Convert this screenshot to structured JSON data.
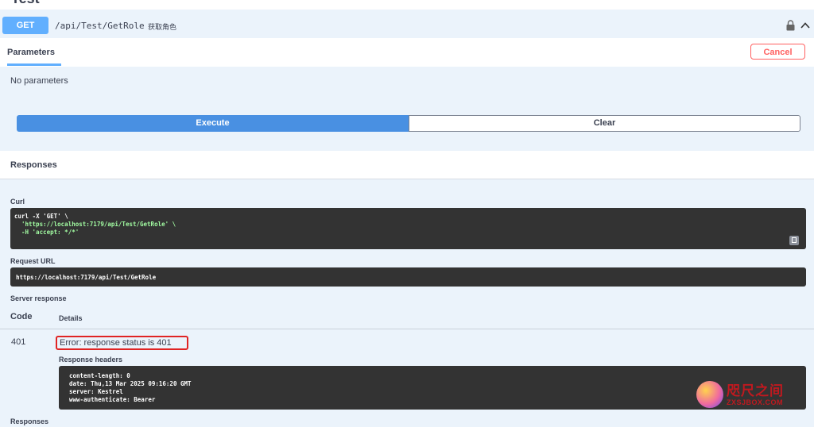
{
  "cut_title": "Test",
  "operation": {
    "method": "GET",
    "path": "/api/Test/GetRole",
    "description": "获取角色"
  },
  "parameters": {
    "tab_label": "Parameters",
    "cancel_label": "Cancel",
    "empty_text": "No parameters"
  },
  "actions": {
    "execute_label": "Execute",
    "clear_label": "Clear"
  },
  "responses": {
    "title": "Responses",
    "curl_label": "Curl",
    "curl_lines": [
      "curl -X 'GET' \\",
      "'https://localhost:7179/api/Test/GetRole' \\",
      "-H 'accept: */*'"
    ],
    "request_url_label": "Request URL",
    "request_url": "https://localhost:7179/api/Test/GetRole",
    "server_response_label": "Server response",
    "code_header": "Code",
    "details_header": "Details",
    "code": "401",
    "error_text": "Error: response status is 401",
    "response_headers_label": "Response headers",
    "response_headers": [
      "content-length: 0",
      "date: Thu,13 Mar 2025 09:16:20 GMT",
      "server: Kestrel",
      "www-authenticate: Bearer"
    ],
    "bottom_label": "Responses"
  },
  "watermark": {
    "cn": "咫尺之间",
    "en": "ZXSJBOX.COM"
  },
  "colors": {
    "get_blue": "#61affe",
    "execute_blue": "#4990e2",
    "cancel_red": "#ff6060",
    "error_red": "#e02424"
  }
}
